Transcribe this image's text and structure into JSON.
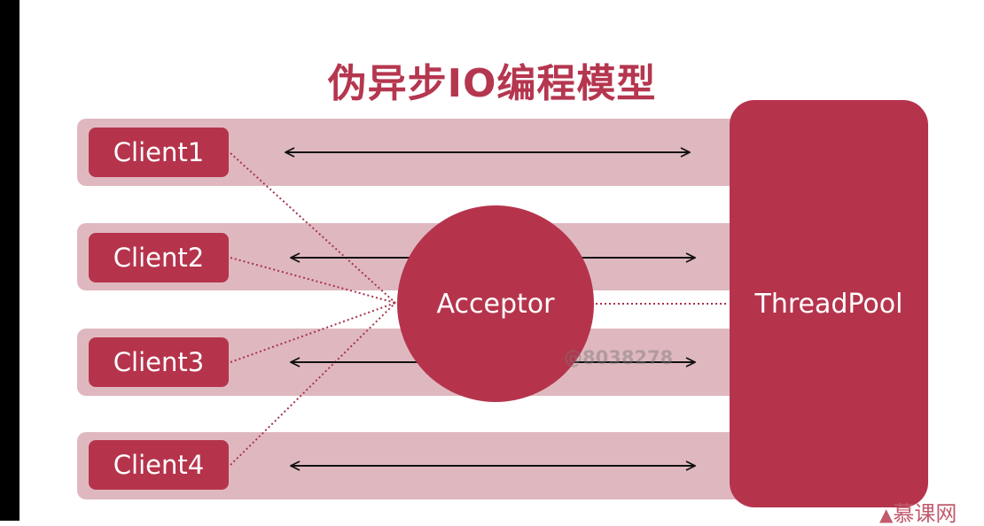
{
  "title": "伪异步IO编程模型",
  "clients": [
    {
      "label": "Client1"
    },
    {
      "label": "Client2"
    },
    {
      "label": "Client3"
    },
    {
      "label": "Client4"
    }
  ],
  "acceptor": {
    "label": "Acceptor"
  },
  "thread_pool": {
    "label": "ThreadPool"
  },
  "watermark": "@8038278",
  "brand": "慕课网",
  "colors": {
    "title": "#b5364f",
    "node_fill": "#b5344c",
    "lane_fill": "#dfb8bf",
    "dotted_line": "#a8324a",
    "arrow": "#111111"
  }
}
